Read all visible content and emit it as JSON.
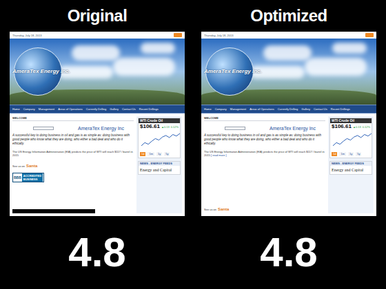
{
  "panels": [
    {
      "label": "Original",
      "score": "4.8",
      "site": {
        "date": "Thursday, July 18, 2013",
        "logo": "AmeraTex Energy Inc.",
        "nav": [
          "Home",
          "Company",
          "Management",
          "Areas of Operations",
          "Currently Drilling",
          "Gallery",
          "Contact Us",
          "Recent Drillings"
        ],
        "welcome": "WELCOME",
        "heading": "AmeraTex Energy Inc",
        "intro": "A successful key to doing business in oil and gas is as simple as: doing business with good people who know what they are doing, who either a bad deal and who do it ethically.",
        "eia": "The US Energy Information Administration (EIA) predicts the price of WTI will reach $117 / barrel in 2015",
        "read_more": "",
        "see_us": "See us on",
        "see_us_brand": "Santa",
        "bbb": {
          "mark": "BBB",
          "line1": "ACCREDITED",
          "line2": "BUSINESS"
        },
        "ticker": {
          "title": "WTI Crude Oil",
          "price": "$106.61",
          "change": "▲0.13",
          "percent": "0.12%",
          "series": [
            104.2,
            104.8,
            104.5,
            105.1,
            105.6,
            105.3,
            105.9,
            106.2,
            105.8,
            106.4,
            106.1,
            106.6
          ],
          "ranges": [
            {
              "label": "1d",
              "selected": true
            },
            {
              "label": "1m",
              "selected": false
            },
            {
              "label": "1y",
              "selected": false
            },
            {
              "label": "5y",
              "selected": false
            }
          ]
        },
        "news_title": "NEWS - ENERGY FEEDS",
        "news_item": "Energy and Capital"
      }
    },
    {
      "label": "Optimized",
      "score": "4.8",
      "site": {
        "date": "Thursday, July 18, 2013",
        "logo": "AmeraTex Energy Inc.",
        "nav": [
          "Home",
          "Company",
          "Management",
          "Areas of Operations",
          "Currently Drilling",
          "Gallery",
          "Contact Us",
          "Recent Drillings"
        ],
        "welcome": "WELCOME",
        "heading": "AmeraTex Energy Inc",
        "intro": "A successful key to doing business in oil and gas is as simple as: doing business with good people who know what they are doing, who either a bad deal and who do it ethically.",
        "eia": "The US Energy Information Administration (EIA) predicts the price of WTI will reach $117 / barrel in 2015",
        "read_more": "[ read more ]",
        "see_us": "See us on",
        "see_us_brand": "Santa",
        "ticker": {
          "title": "WTI Crude Oil",
          "price": "$106.61",
          "change": "▲0.13",
          "percent": "0.12%",
          "series": [
            104.2,
            104.8,
            104.5,
            105.1,
            105.6,
            105.3,
            105.9,
            106.2,
            105.8,
            106.4,
            106.1,
            106.6
          ],
          "ranges": [
            {
              "label": "1d",
              "selected": true
            },
            {
              "label": "1m",
              "selected": false
            },
            {
              "label": "1y",
              "selected": false
            },
            {
              "label": "5y",
              "selected": false
            }
          ]
        },
        "news_title": "NEWS - ENERGY FEEDS",
        "news_item": "Energy and Capital"
      }
    }
  ]
}
